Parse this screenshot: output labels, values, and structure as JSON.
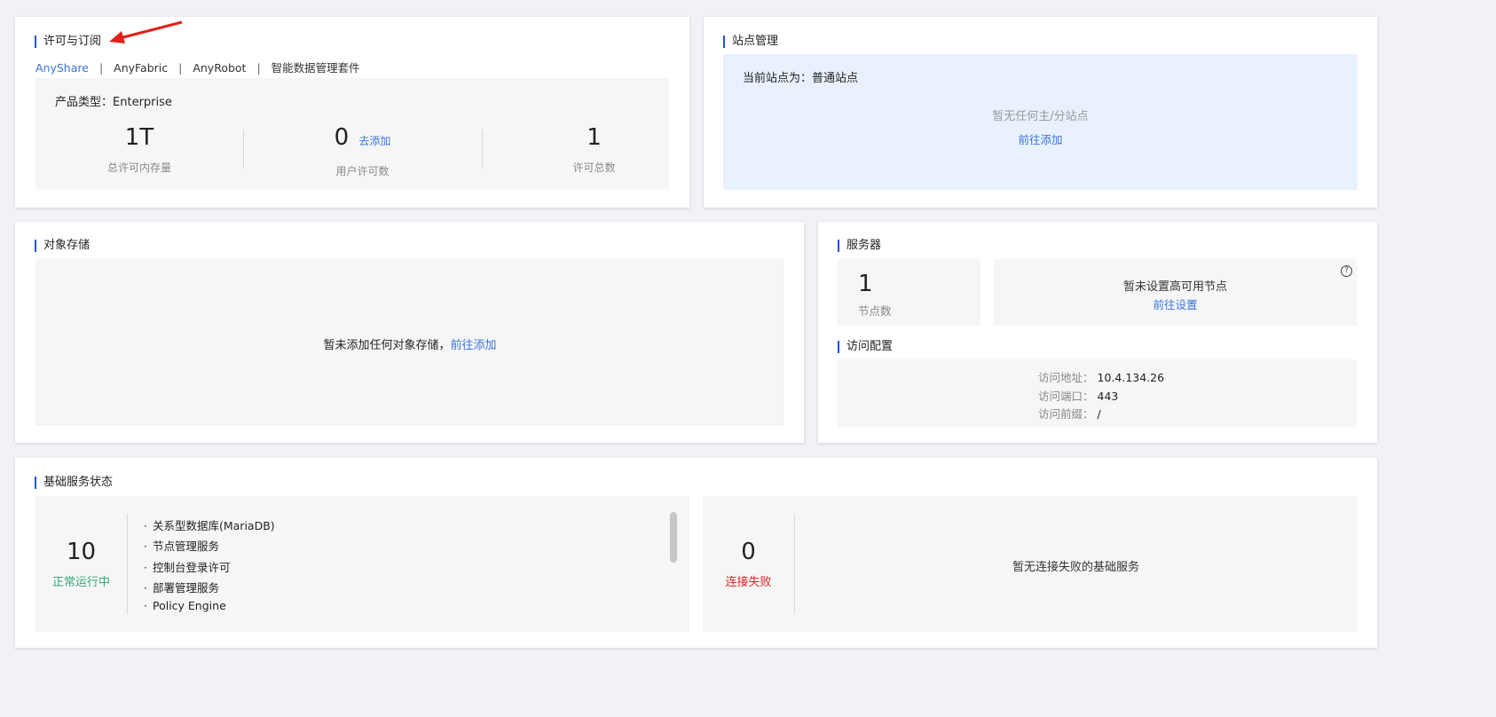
{
  "license": {
    "title": "许可与订阅",
    "tabs": [
      {
        "label": "AnyShare",
        "active": true
      },
      {
        "label": "AnyFabric",
        "active": false
      },
      {
        "label": "AnyRobot",
        "active": false
      },
      {
        "label": "智能数据管理套件",
        "active": false
      }
    ],
    "separator": "|",
    "product_type_label": "产品类型：",
    "product_type_value": "Enterprise",
    "stats": [
      {
        "value": "1T",
        "label": "总许可内存量"
      },
      {
        "value": "0",
        "label": "用户许可数",
        "action": "去添加"
      },
      {
        "value": "1",
        "label": "许可总数"
      }
    ]
  },
  "site": {
    "title": "站点管理",
    "current_label": "当前站点为：普通站点",
    "empty_text": "暂无任何主/分站点",
    "action": "前往添加"
  },
  "object_storage": {
    "title": "对象存储",
    "empty_text": "暂未添加任何对象存储，",
    "action": "前往添加"
  },
  "server": {
    "title": "服务器",
    "node_count": "1",
    "node_label": "节点数",
    "ha_text": "暂未设置高可用节点",
    "ha_action": "前往设置",
    "help_icon": "?"
  },
  "access": {
    "title": "访问配置",
    "rows": [
      {
        "label": "访问地址：",
        "value": "10.4.134.26"
      },
      {
        "label": "访问端口：",
        "value": "443"
      },
      {
        "label": "访问前缀：",
        "value": "/"
      }
    ]
  },
  "services": {
    "title": "基础服务状态",
    "running_count": "10",
    "running_label": "正常运行中",
    "running_list": [
      "关系型数据库(MariaDB)",
      "节点管理服务",
      "控制台登录许可",
      "部署管理服务",
      "Policy Engine"
    ],
    "failed_count": "0",
    "failed_label": "连接失败",
    "failed_empty": "暂无连接失败的基础服务",
    "bullet": "·"
  },
  "colors": {
    "accent": "#1a56db",
    "link": "#3b73d9",
    "success": "#3aa776",
    "danger": "#e02424",
    "site_panel_bg": "#e8f1fd",
    "arrow": "#e0211b"
  }
}
